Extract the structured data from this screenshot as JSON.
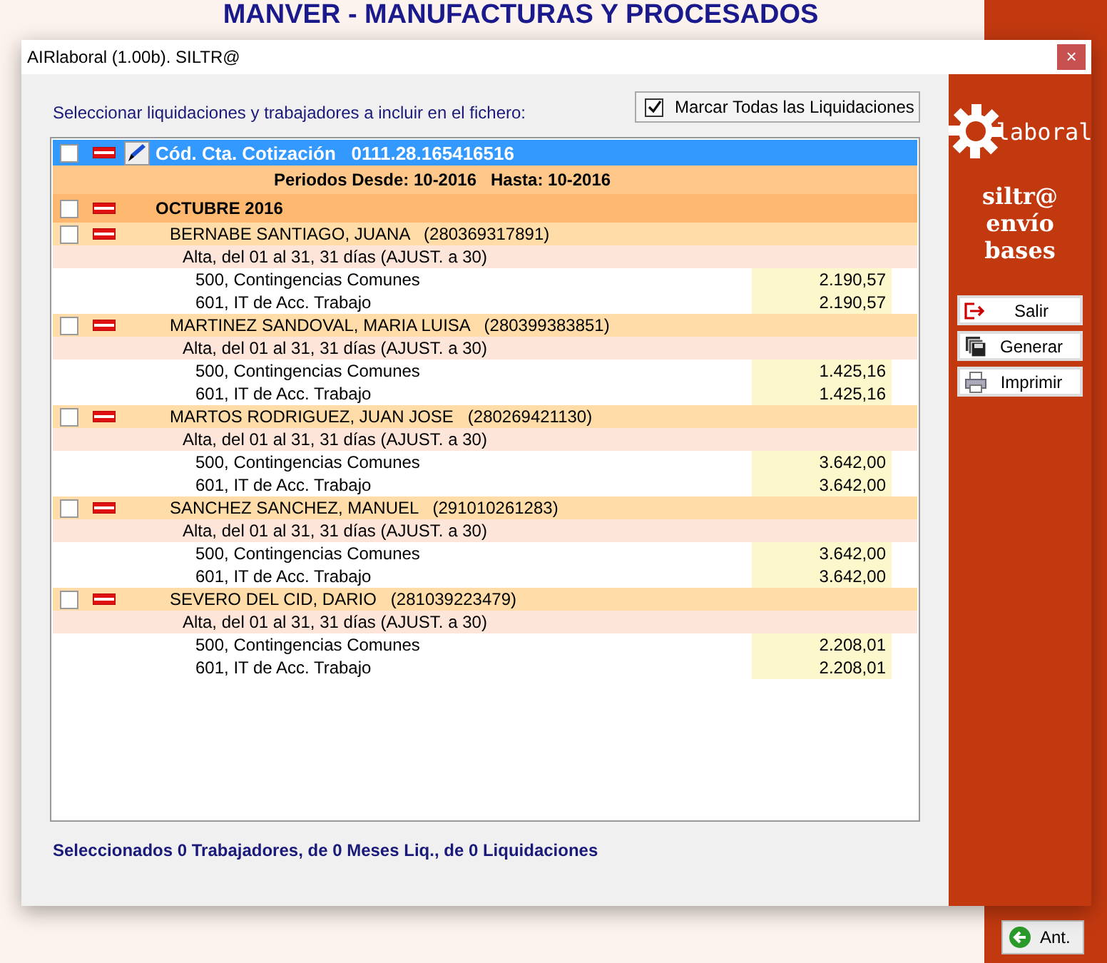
{
  "background_app": {
    "title": "MANVER - MANUFACTURAS Y PROCESADOS",
    "side_button": "Ant."
  },
  "window": {
    "title": "AIRlaboral (1.00b). SILTR@",
    "close": "×"
  },
  "instruction": "Seleccionar liquidaciones y trabajadores a incluir en el fichero:",
  "mark_all": {
    "label": "Marcar Todas las Liquidaciones",
    "checked": true
  },
  "tree": [
    {
      "kind": "account",
      "label": "Cód. Cta. Cotización",
      "code": "0111.28.165416516",
      "checked": false,
      "expanded": true,
      "selected": true,
      "period": "Periodos Desde: 10-2016   Hasta: 10-2016",
      "children": [
        {
          "label": "OCTUBRE 2016",
          "checked": false,
          "expanded": true,
          "children": [
            {
              "kind": "worker",
              "name": "BERNABE SANTIAGO, JUANA",
              "nss": "(280369317891)",
              "checked": false,
              "expanded": true,
              "status": "Alta, del 01 al 31, 31 días (AJUST. a 30)",
              "concepts": [
                {
                  "label": "500, Contingencias Comunes",
                  "amount": "2.190,57"
                },
                {
                  "label": "601, IT de Acc. Trabajo",
                  "amount": "2.190,57"
                }
              ]
            },
            {
              "kind": "worker",
              "name": "MARTINEZ SANDOVAL, MARIA LUISA",
              "nss": "(280399383851)",
              "checked": false,
              "expanded": true,
              "status": "Alta, del 01 al 31, 31 días (AJUST. a 30)",
              "concepts": [
                {
                  "label": "500, Contingencias Comunes",
                  "amount": "1.425,16"
                },
                {
                  "label": "601, IT de Acc. Trabajo",
                  "amount": "1.425,16"
                }
              ]
            },
            {
              "kind": "worker",
              "name": "MARTOS RODRIGUEZ, JUAN JOSE",
              "nss": "(280269421130)",
              "checked": false,
              "expanded": true,
              "status": "Alta, del 01 al 31, 31 días (AJUST. a 30)",
              "concepts": [
                {
                  "label": "500, Contingencias Comunes",
                  "amount": "3.642,00"
                },
                {
                  "label": "601, IT de Acc. Trabajo",
                  "amount": "3.642,00"
                }
              ]
            },
            {
              "kind": "worker",
              "name": "SANCHEZ SANCHEZ, MANUEL",
              "nss": "(291010261283)",
              "checked": false,
              "expanded": true,
              "status": "Alta, del 01 al 31, 31 días (AJUST. a 30)",
              "concepts": [
                {
                  "label": "500, Contingencias Comunes",
                  "amount": "3.642,00"
                },
                {
                  "label": "601, IT de Acc. Trabajo",
                  "amount": "3.642,00"
                }
              ]
            },
            {
              "kind": "worker",
              "name": "SEVERO DEL CID, DARIO",
              "nss": "(281039223479)",
              "checked": false,
              "expanded": true,
              "status": "Alta, del 01 al 31, 31 días (AJUST. a 30)",
              "concepts": [
                {
                  "label": "500, Contingencias Comunes",
                  "amount": "2.208,01"
                },
                {
                  "label": "601, IT de Acc. Trabajo",
                  "amount": "2.208,01"
                }
              ]
            }
          ]
        }
      ]
    }
  ],
  "status": "Seleccionados 0 Trabajadores, de 0 Meses Liq., de 0 Liquidaciones",
  "side_panel": {
    "logo": "laboral",
    "title": "siltr@ envío bases",
    "buttons": [
      {
        "kind": "exit",
        "label": "Salir"
      },
      {
        "kind": "generate",
        "label": "Generar"
      },
      {
        "kind": "print",
        "label": "Imprimir"
      }
    ]
  }
}
